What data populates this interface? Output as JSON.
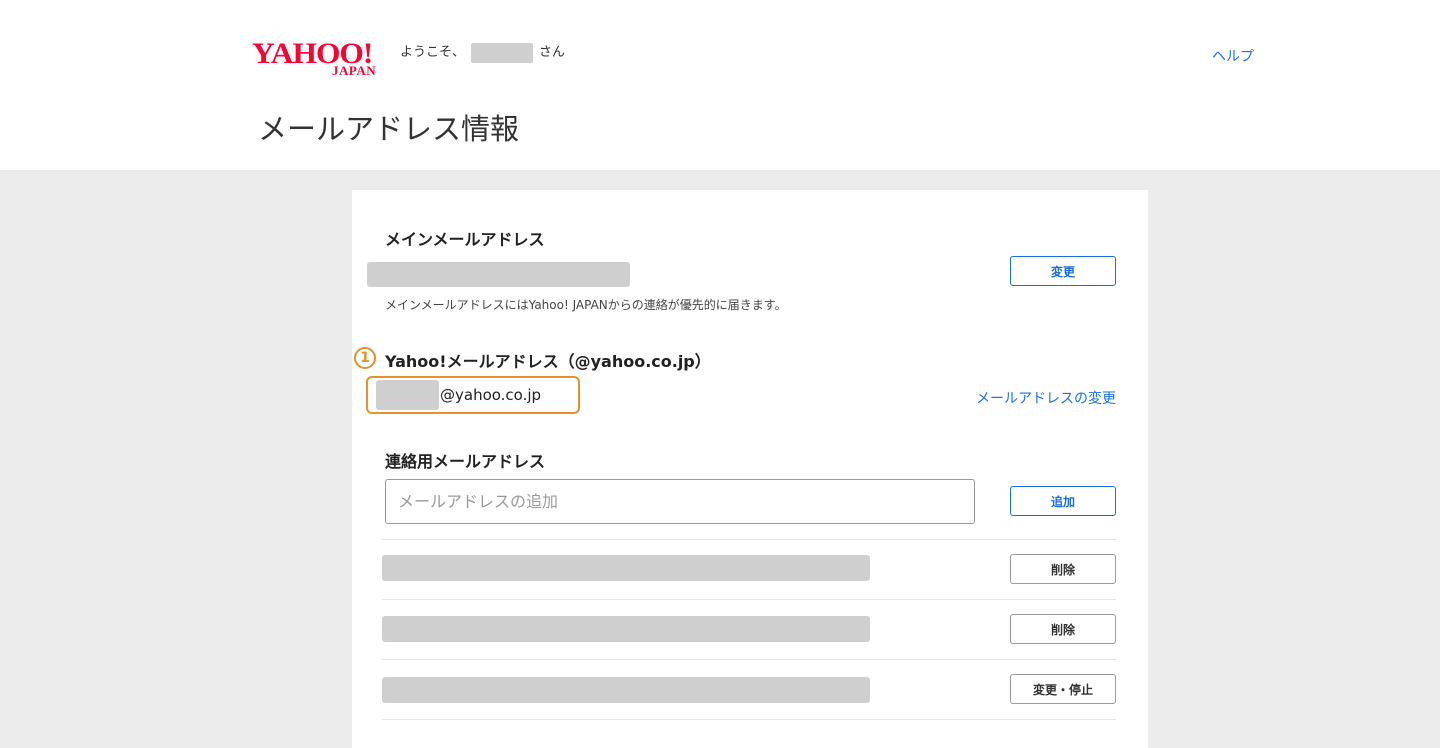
{
  "header": {
    "logo_main": "YAHOO!",
    "logo_sub": "JAPAN",
    "welcome_prefix": "ようこそ、",
    "welcome_suffix": "さん",
    "help_label": "ヘルプ"
  },
  "page_title": "メールアドレス情報",
  "main_address": {
    "title": "メインメールアドレス",
    "change_label": "変更",
    "note": "メインメールアドレスにはYahoo! JAPANからの連絡が優先的に届きます。"
  },
  "yahoo_mail": {
    "marker": "1",
    "title": "Yahoo!メールアドレス（@yahoo.co.jp）",
    "address_suffix": "@yahoo.co.jp",
    "change_link": "メールアドレスの変更"
  },
  "contact": {
    "title": "連絡用メールアドレス",
    "input_placeholder": "メールアドレスの追加",
    "add_label": "追加",
    "rows": [
      {
        "action": "削除"
      },
      {
        "action": "削除"
      },
      {
        "action": "変更・停止"
      }
    ]
  },
  "colors": {
    "brand": "#ff0033",
    "link": "#1a73e8",
    "highlight": "#e8912b",
    "background": "#ececec"
  }
}
